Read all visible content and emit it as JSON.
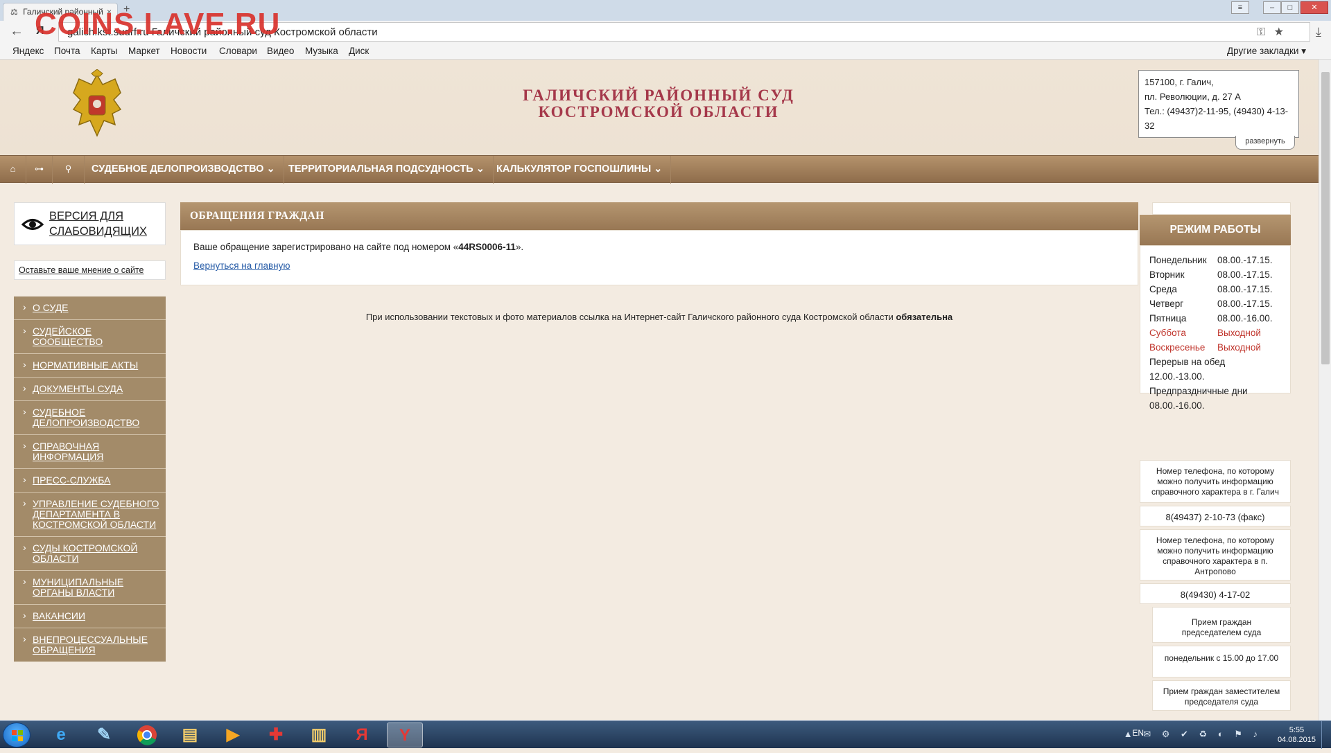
{
  "browser": {
    "tab_title": "Галичский районный",
    "tab_close": "×",
    "new_tab": "+",
    "watermark": "COINS.LAVE.RU",
    "url": "galich.kst.sudrf.ru   Галичский районный суд Костромской области",
    "bookmarks": [
      "Яндекс",
      "Почта",
      "Карты",
      "Маркет",
      "Новости",
      "Словари",
      "Видео",
      "Музыка",
      "Диск"
    ],
    "bookmarks_other": "Другие закладки ▾"
  },
  "header": {
    "title_line1": "ГАЛИЧСКИЙ РАЙОННЫЙ СУД",
    "title_line2": "КОСТРОМСКОЙ ОБЛАСТИ",
    "address_line1": "157100, г. Галич,",
    "address_line2": "пл. Революции, д. 27 А",
    "phone_line": "Тел.: (49437)2-11-95, (49430) 4-13-32",
    "expand_label": "развернуть"
  },
  "nav": {
    "items": [
      "СУДЕБНОЕ ДЕЛОПРОИЗВОДСТВО ⌄",
      "ТЕРРИТОРИАЛЬНАЯ ПОДСУДНОСТЬ ⌄",
      "КАЛЬКУЛЯТОР ГОСПОШЛИНЫ ⌄"
    ]
  },
  "sidebar": {
    "vision_label": "ВЕРСИЯ ДЛЯ СЛАБОВИДЯЩИХ",
    "feedback_label": "Оставьте ваше мнение о сайте",
    "menu": [
      "О суде",
      "Судейское сообщество",
      "Нормативные акты",
      "Документы суда",
      "Судебное делопроизводство",
      "Справочная информация",
      "Пресс-служба",
      "Управление Судебного департамента в Костромской области",
      "Суды Костромской области",
      "Муниципальные органы власти",
      "Вакансии",
      "Внепроцессуальные обращения"
    ]
  },
  "main": {
    "heading": "ОБРАЩЕНИЯ ГРАЖДАН",
    "message_before": "Ваше обращение зарегистрировано на сайте под номером «",
    "reg_number": "44RS0006-11",
    "message_after": "».",
    "back_link": "Вернуться на главную",
    "copyright_text": "При использовании текстовых и фото материалов ссылка на Интернет-сайт Галичского районного суда Костромской области ",
    "copyright_bold": "обязательна"
  },
  "schedule": {
    "heading": "РЕЖИМ РАБОТЫ",
    "rows": [
      {
        "day": "Понедельник",
        "hours": "08.00.-17.15."
      },
      {
        "day": "Вторник",
        "hours": "08.00.-17.15."
      },
      {
        "day": "Среда",
        "hours": "08.00.-17.15."
      },
      {
        "day": "Четверг",
        "hours": "08.00.-17.15."
      },
      {
        "day": "Пятница",
        "hours": "08.00.-16.00."
      },
      {
        "day": "Суббота",
        "hours": "Выходной"
      },
      {
        "day": "Воскресенье",
        "hours": "Выходной"
      }
    ],
    "lunch_label": "Перерыв на обед",
    "lunch_hours": "12.00.-13.00.",
    "preholiday_label": "Предпраздничные дни",
    "preholiday_hours": "08.00.-16.00."
  },
  "info_cards": {
    "phone_galich_label": "Номер телефона, по которому можно получить информацию справочного характера в г. Галич",
    "phone_galich": "8(49437) 2-10-73 (факс)",
    "phone_antropovo_label": "Номер телефона, по которому можно получить информацию справочного характера в п. Антропово",
    "phone_antropovo": "8(49430) 4-17-02",
    "reception_chairman": "Прием граждан председателем суда",
    "reception_chairman_time": "понедельник с 15.00 до 17.00",
    "reception_deputy": "Прием граждан заместителем председателя суда"
  },
  "taskbar": {
    "lang": "EN",
    "time": "5:55",
    "date": "04.08.2015"
  },
  "colors": {
    "accent_brown": "#987754",
    "title_red": "#a5384a",
    "day_off_red": "#c0352c",
    "link_blue": "#2a5ea8"
  }
}
